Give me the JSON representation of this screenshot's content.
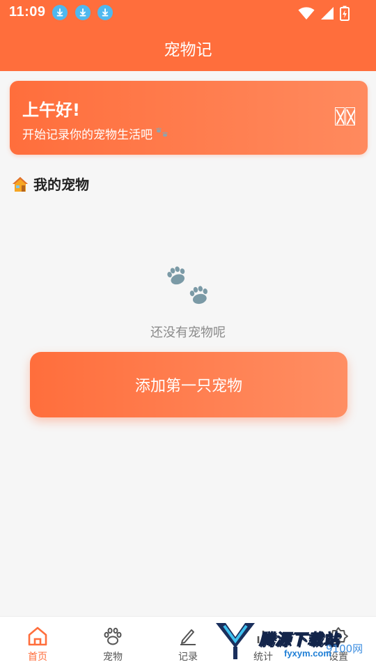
{
  "status_bar": {
    "time": "11:09",
    "notification_icons": [
      "download-icon",
      "download-icon",
      "download-icon"
    ],
    "system_icons": [
      "wifi-icon",
      "cell-signal-icon",
      "battery-charging-icon"
    ]
  },
  "header": {
    "title": "宠物记"
  },
  "greeting_card": {
    "title": "上午好!",
    "subtitle": "开始记录你的宠物生活吧",
    "subtitle_icon": "paw-icon",
    "right_icon": "unrendered-glyph-icon"
  },
  "my_pets": {
    "icon": "house-icon",
    "title": "我的宠物",
    "empty_icon": "paw-icon",
    "empty_text": "还没有宠物呢",
    "add_button_label": "添加第一只宠物"
  },
  "tabbar": {
    "items": [
      {
        "label": "首页",
        "icon": "home-icon",
        "active": true
      },
      {
        "label": "宠物",
        "icon": "paw-icon",
        "active": false
      },
      {
        "label": "记录",
        "icon": "pencil-icon",
        "active": false
      },
      {
        "label": "统计",
        "icon": "chart-icon",
        "active": false
      },
      {
        "label": "设置",
        "icon": "gear-icon",
        "active": false
      }
    ]
  },
  "watermark": {
    "text": "腾源下载站",
    "url": "fyxym.com",
    "site": "9100网"
  },
  "colors": {
    "brand": "#ff6e3c",
    "background": "#f6f6f6",
    "muted_text": "#8a8a8a"
  }
}
